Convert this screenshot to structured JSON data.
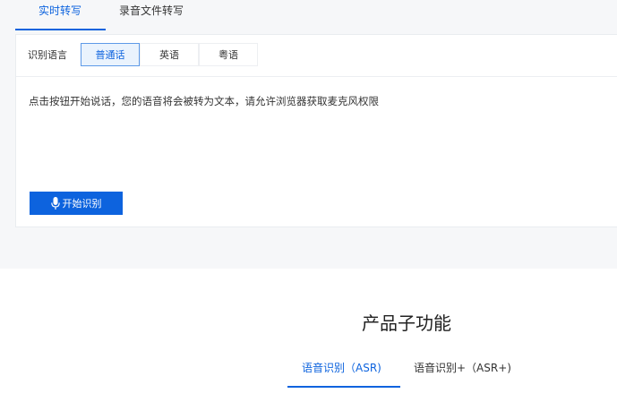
{
  "tabs": {
    "realtime": "实时转写",
    "file": "录音文件转写"
  },
  "language": {
    "label": "识别语言",
    "options": [
      "普通话",
      "英语",
      "粤语"
    ],
    "selected": "普通话"
  },
  "hint": "点击按钮开始说话，您的语音将会被转为文本，请允许浏览器获取麦克风权限",
  "start_button": {
    "label": "开始识别",
    "icon": "microphone-icon"
  },
  "section": {
    "title": "产品子功能",
    "tabs": [
      "语音识别（ASR)",
      "语音识别+（ASR+)"
    ]
  },
  "colors": {
    "accent": "#0d63de",
    "background_band": "#f6f7f9",
    "selected_bg": "#eaf3fd"
  }
}
